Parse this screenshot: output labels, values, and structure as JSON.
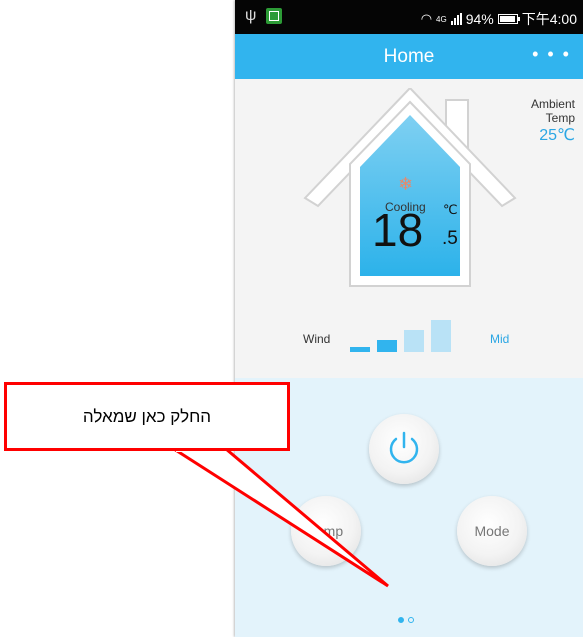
{
  "status_bar": {
    "network_label": "4G",
    "battery": "94%",
    "time": "下午4:00"
  },
  "nav": {
    "title": "Home",
    "more_icon": "more-horizontal-icon"
  },
  "ambient": {
    "label_line1": "Ambient",
    "label_line2": "Temp",
    "value": "25℃"
  },
  "thermostat": {
    "mode": "Cooling",
    "mode_icon": "snowflake-icon",
    "temp_integer": "18",
    "temp_decimal": ".5",
    "temp_unit": "℃"
  },
  "wind": {
    "label": "Wind",
    "level": "Mid",
    "active_bars": 2,
    "total_bars": 4
  },
  "controls": {
    "power_icon": "power-icon",
    "temp_label": "Temp",
    "mode_label": "Mode"
  },
  "pagination": {
    "current_page": 1,
    "total_pages": 2
  },
  "annotation": {
    "text": "החלק כאן שמאלה"
  },
  "colors": {
    "accent": "#31b4ee",
    "ambient_value": "#2aa6e4",
    "control_background": "#e3f3fb",
    "annotation_border": "#ff0000",
    "snowflake": "#e9886a"
  }
}
